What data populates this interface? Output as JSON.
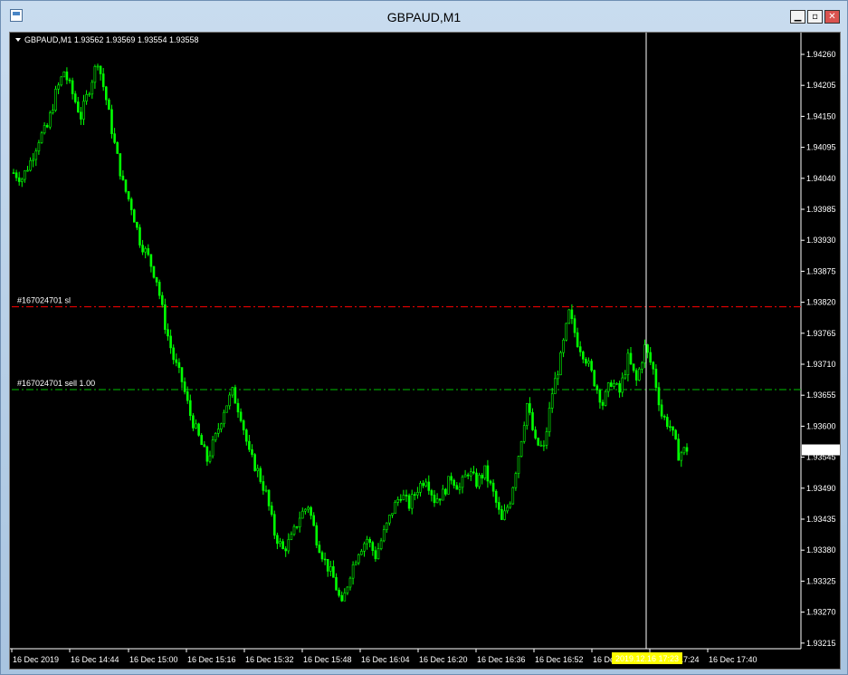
{
  "window": {
    "title": "GBPAUD,M1",
    "buttons": [
      "minimize",
      "restore",
      "close"
    ],
    "button_glyphs": {
      "minimize": "▁",
      "restore": "▫",
      "close": "✕"
    }
  },
  "chart": {
    "header_symbol": "GBPAUD,M1",
    "ohlc": "1.93562 1.93569 1.93554 1.93558",
    "current_price_label": "1.93558",
    "crosshair_time": "2019.12.16 17:23",
    "colors": {
      "background": "#000000",
      "candles": "#00ff00",
      "grid_text": "#ffffff",
      "sl_line": "#ff0000",
      "order_line": "#00c000",
      "crosshair": "#ffffff",
      "time_tag": "#ffff00"
    }
  },
  "order_lines": [
    {
      "label": "#167024701 sl",
      "price": 1.93812,
      "color": "#ff0000"
    },
    {
      "label": "#167024701 sell 1.00",
      "price": 1.93665,
      "color": "#00c000"
    }
  ],
  "price_axis": [
    "1.94260",
    "1.94205",
    "1.94150",
    "1.94095",
    "1.94040",
    "1.93985",
    "1.93930",
    "1.93875",
    "1.93820",
    "1.93765",
    "1.93710",
    "1.93655",
    "1.93600",
    "1.93545",
    "1.93490",
    "1.93435",
    "1.93380",
    "1.93325",
    "1.93270",
    "1.93215"
  ],
  "time_axis": [
    "16 Dec 2019",
    "16 Dec 14:44",
    "16 Dec 15:00",
    "16 Dec 15:16",
    "16 Dec 15:32",
    "16 Dec 15:48",
    "16 Dec 16:04",
    "16 Dec 16:20",
    "16 Dec 16:36",
    "16 Dec 16:52",
    "16 Dec 17:08",
    "16 Dec 17:24",
    "16 Dec 17:40"
  ],
  "chart_data": {
    "type": "candlestick",
    "symbol": "GBPAUD",
    "timeframe": "M1",
    "ylim": [
      1.9321,
      1.9429
    ],
    "close_path": [
      [
        0,
        1.9405
      ],
      [
        3,
        1.9404
      ],
      [
        6,
        1.9407
      ],
      [
        9,
        1.9411
      ],
      [
        12,
        1.9413
      ],
      [
        15,
        1.9419
      ],
      [
        18,
        1.9423
      ],
      [
        21,
        1.9419
      ],
      [
        24,
        1.9415
      ],
      [
        27,
        1.942
      ],
      [
        30,
        1.9425
      ],
      [
        33,
        1.9418
      ],
      [
        36,
        1.941
      ],
      [
        39,
        1.9403
      ],
      [
        42,
        1.9399
      ],
      [
        45,
        1.9393
      ],
      [
        48,
        1.939
      ],
      [
        51,
        1.9386
      ],
      [
        54,
        1.9378
      ],
      [
        57,
        1.9372
      ],
      [
        60,
        1.9368
      ],
      [
        63,
        1.9362
      ],
      [
        66,
        1.9358
      ],
      [
        69,
        1.9354
      ],
      [
        72,
        1.9358
      ],
      [
        75,
        1.9363
      ],
      [
        78,
        1.9366
      ],
      [
        81,
        1.9362
      ],
      [
        84,
        1.9355
      ],
      [
        87,
        1.9352
      ],
      [
        90,
        1.9348
      ],
      [
        93,
        1.9341
      ],
      [
        96,
        1.9338
      ],
      [
        99,
        1.934
      ],
      [
        102,
        1.9344
      ],
      [
        105,
        1.9346
      ],
      [
        108,
        1.934
      ],
      [
        111,
        1.9336
      ],
      [
        114,
        1.9333
      ],
      [
        117,
        1.9328
      ],
      [
        120,
        1.9334
      ],
      [
        123,
        1.9338
      ],
      [
        126,
        1.934
      ],
      [
        129,
        1.9337
      ],
      [
        132,
        1.9341
      ],
      [
        135,
        1.9345
      ],
      [
        138,
        1.9348
      ],
      [
        141,
        1.9346
      ],
      [
        144,
        1.9349
      ],
      [
        147,
        1.9351
      ],
      [
        150,
        1.9347
      ],
      [
        153,
        1.9348
      ],
      [
        156,
        1.9351
      ],
      [
        159,
        1.9349
      ],
      [
        162,
        1.9352
      ],
      [
        165,
        1.935
      ],
      [
        168,
        1.9352
      ],
      [
        171,
        1.9348
      ],
      [
        174,
        1.9343
      ],
      [
        177,
        1.9347
      ],
      [
        180,
        1.9355
      ],
      [
        183,
        1.9364
      ],
      [
        186,
        1.9357
      ],
      [
        189,
        1.9356
      ],
      [
        192,
        1.9366
      ],
      [
        195,
        1.9372
      ],
      [
        198,
        1.938
      ],
      [
        201,
        1.9375
      ],
      [
        204,
        1.9372
      ],
      [
        207,
        1.9368
      ],
      [
        210,
        1.9364
      ],
      [
        213,
        1.9368
      ],
      [
        216,
        1.9366
      ],
      [
        219,
        1.9372
      ],
      [
        222,
        1.9368
      ],
      [
        225,
        1.9374
      ],
      [
        228,
        1.937
      ],
      [
        231,
        1.9362
      ],
      [
        234,
        1.936
      ],
      [
        237,
        1.9355
      ],
      [
        240,
        1.9356
      ]
    ]
  }
}
